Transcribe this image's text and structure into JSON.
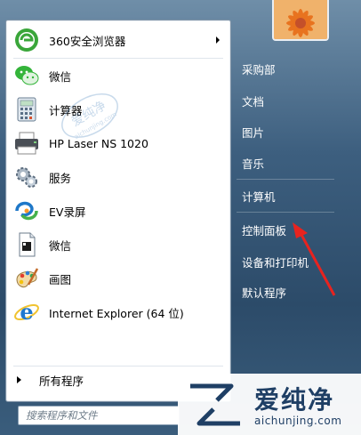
{
  "pinned_programs": [
    {
      "label": "360安全浏览器",
      "icon": "360-browser-icon",
      "has_submenu": true
    },
    {
      "label": "微信",
      "icon": "wechat-icon",
      "has_submenu": false
    },
    {
      "label": "计算器",
      "icon": "calculator-icon",
      "has_submenu": false
    },
    {
      "label": "HP Laser NS 1020",
      "icon": "printer-icon",
      "has_submenu": false
    },
    {
      "label": "服务",
      "icon": "gears-icon",
      "has_submenu": false
    },
    {
      "label": "EV录屏",
      "icon": "ev-recorder-icon",
      "has_submenu": false
    },
    {
      "label": "微信",
      "icon": "document-icon",
      "has_submenu": false
    },
    {
      "label": "画图",
      "icon": "paint-icon",
      "has_submenu": false
    },
    {
      "label": "Internet Explorer (64 位)",
      "icon": "ie-icon",
      "has_submenu": false
    }
  ],
  "all_programs_label": "所有程序",
  "search": {
    "placeholder": "搜索程序和文件",
    "value": ""
  },
  "right_items": [
    {
      "label": "采购部"
    },
    {
      "label": "文档"
    },
    {
      "label": "图片"
    },
    {
      "label": "音乐"
    },
    {
      "label": "计算机"
    },
    {
      "label": "控制面板"
    },
    {
      "label": "设备和打印机"
    },
    {
      "label": "默认程序"
    }
  ],
  "watermark": {
    "brand": "爱纯净",
    "domain": "aichunjing.com",
    "stamp_text": "爱纯净",
    "stamp_domain": "aichunjing.com"
  },
  "colors": {
    "accent_red": "#e8231f",
    "ie_blue": "#1e78d0",
    "browser_green": "#3aa63a",
    "wechat_green": "#34b43a"
  }
}
